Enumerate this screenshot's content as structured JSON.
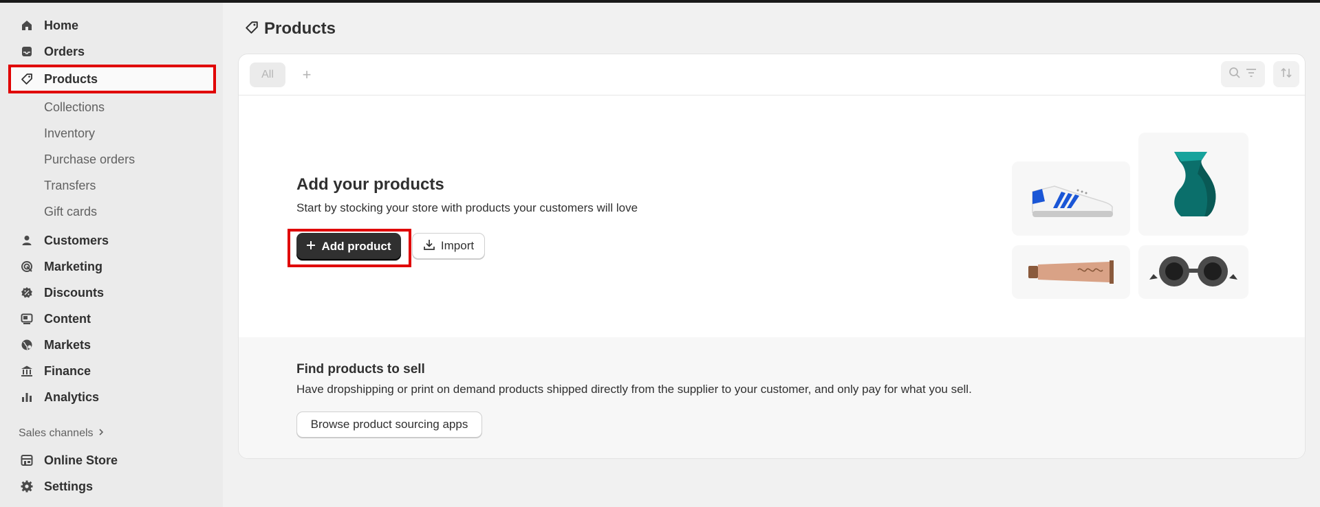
{
  "sidebar": {
    "items": [
      {
        "label": "Home",
        "icon": "home-icon"
      },
      {
        "label": "Orders",
        "icon": "inbox-icon"
      },
      {
        "label": "Products",
        "icon": "tag-icon"
      },
      {
        "label": "Collections"
      },
      {
        "label": "Inventory"
      },
      {
        "label": "Purchase orders"
      },
      {
        "label": "Transfers"
      },
      {
        "label": "Gift cards"
      },
      {
        "label": "Customers",
        "icon": "person-icon"
      },
      {
        "label": "Marketing",
        "icon": "target-icon"
      },
      {
        "label": "Discounts",
        "icon": "discount-icon"
      },
      {
        "label": "Content",
        "icon": "content-icon"
      },
      {
        "label": "Markets",
        "icon": "globe-icon"
      },
      {
        "label": "Finance",
        "icon": "bank-icon"
      },
      {
        "label": "Analytics",
        "icon": "bar-chart-icon"
      }
    ],
    "sales_channels_label": "Sales channels",
    "bottom": [
      {
        "label": "Online Store",
        "icon": "store-icon"
      },
      {
        "label": "Settings",
        "icon": "gear-icon"
      }
    ]
  },
  "page": {
    "title": "Products",
    "tabs": [
      {
        "label": "All"
      }
    ],
    "add_tab": "+"
  },
  "empty_state": {
    "title": "Add your products",
    "subtitle": "Start by stocking your store with products your customers will love",
    "add_button": "Add product",
    "import_button": "Import"
  },
  "sourcing": {
    "title": "Find products to sell",
    "subtitle": "Have dropshipping or print on demand products shipped directly from the supplier to your customer, and only pay for what you sell.",
    "button": "Browse product sourcing apps"
  },
  "colors": {
    "highlight": "#e00000",
    "primary_button": "#303030",
    "sidebar_bg": "#ebebeb"
  }
}
